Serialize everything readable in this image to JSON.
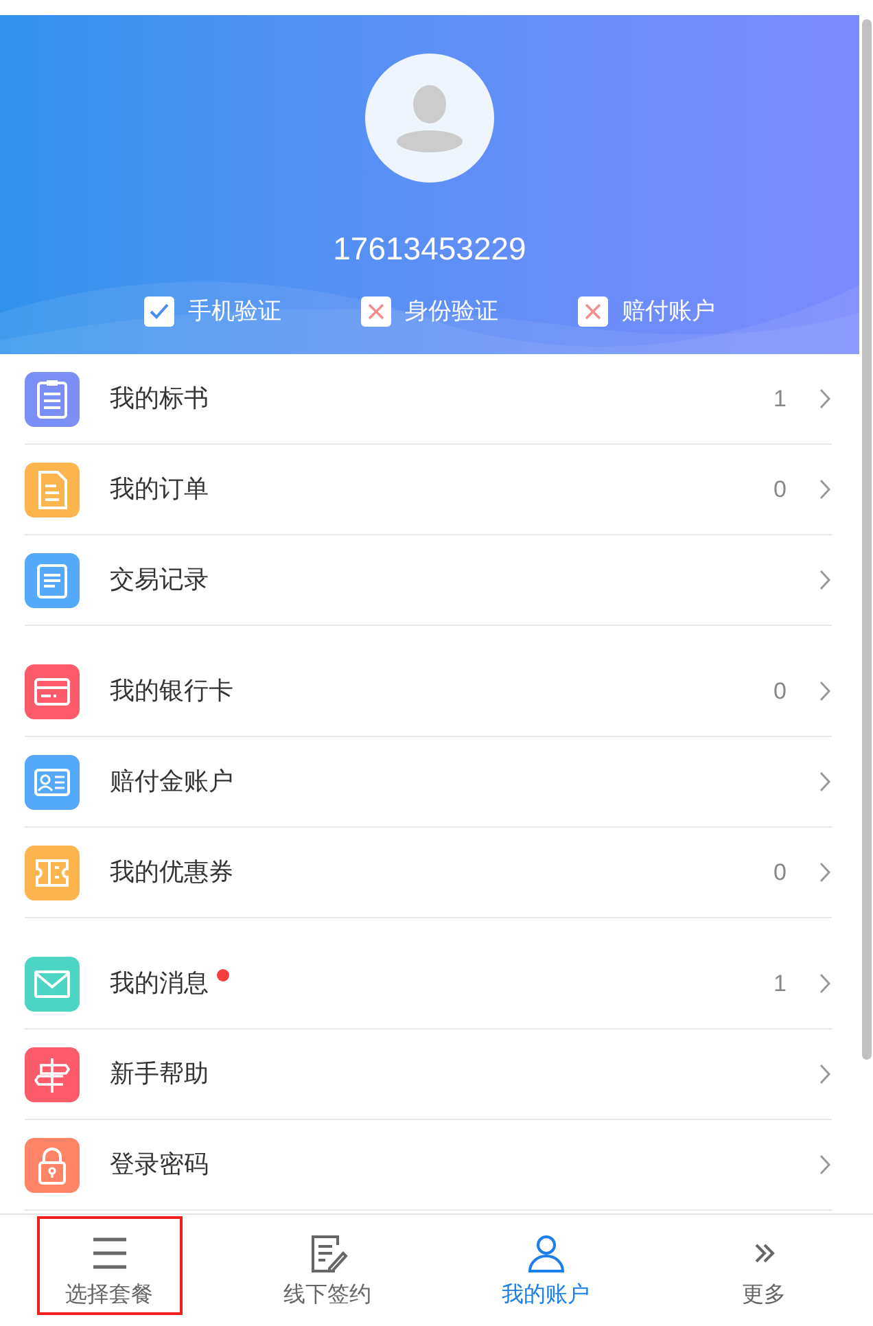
{
  "profile": {
    "phone": "17613453229"
  },
  "verifications": [
    {
      "label": "手机验证",
      "verified": true
    },
    {
      "label": "身份验证",
      "verified": false
    },
    {
      "label": "赔付账户",
      "verified": false
    }
  ],
  "groups": [
    {
      "items": [
        {
          "label": "我的标书",
          "color": "#7b8ff7",
          "count": "1",
          "unread_dot": false
        },
        {
          "label": "我的订单",
          "color": "#fbb44e",
          "count": "0",
          "unread_dot": false
        },
        {
          "label": "交易记录",
          "color": "#54a9fb",
          "unread_dot": false
        }
      ]
    },
    {
      "items": [
        {
          "label": "我的银行卡",
          "color": "#fc5c6a",
          "count": "0",
          "unread_dot": false
        },
        {
          "label": "赔付金账户",
          "color": "#54a9fb",
          "unread_dot": false
        },
        {
          "label": "我的优惠券",
          "color": "#fbb44e",
          "count": "0",
          "unread_dot": false
        }
      ]
    },
    {
      "items": [
        {
          "label": "我的消息",
          "color": "#4cd5c2",
          "count": "1",
          "unread_dot": true
        },
        {
          "label": "新手帮助",
          "color": "#fc5c6a",
          "unread_dot": false
        },
        {
          "label": "登录密码",
          "color": "#fd8466",
          "unread_dot": false
        }
      ]
    }
  ],
  "tab_bar": [
    {
      "label": "选择套餐",
      "selected": false,
      "outlined": true
    },
    {
      "label": "线下签约",
      "selected": false,
      "outlined": false
    },
    {
      "label": "我的账户",
      "selected": true,
      "outlined": false
    },
    {
      "label": "更多",
      "selected": false,
      "outlined": false
    }
  ]
}
